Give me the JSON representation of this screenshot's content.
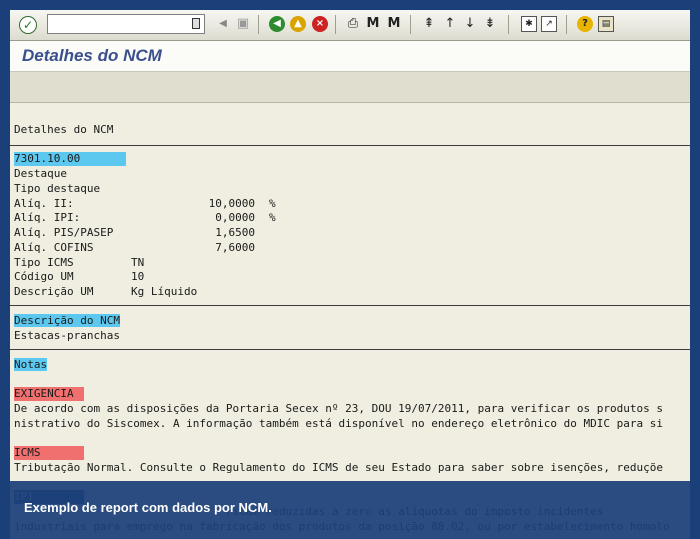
{
  "window": {
    "title": "Detalhes do NCM"
  },
  "toolbar": {
    "command_value": "",
    "icons": [
      "enter-icon",
      "back-icon",
      "save-icon",
      "back-nav-icon",
      "exit-icon",
      "cancel-icon",
      "print-icon",
      "find-icon",
      "find-next-icon",
      "first-page-icon",
      "prev-page-icon",
      "next-page-icon",
      "last-page-icon",
      "new-session-icon",
      "shortcut-icon",
      "help-icon",
      "layout-icon"
    ]
  },
  "report": {
    "heading": "Detalhes do NCM",
    "ncm_code": "7301.10.00",
    "fields": [
      {
        "label": "Destaque",
        "value": "",
        "unit": ""
      },
      {
        "label": "Tipo destaque",
        "value": "",
        "unit": ""
      },
      {
        "label": "Alíq. II:",
        "value": "10,0000",
        "unit": "%"
      },
      {
        "label": "Alíq. IPI:",
        "value": "0,0000",
        "unit": "%"
      },
      {
        "label": "Alíq. PIS/PASEP",
        "value": "1,6500",
        "unit": ""
      },
      {
        "label": "Alíq. COFINS",
        "value": "7,6000",
        "unit": ""
      },
      {
        "label": "Tipo ICMS",
        "value": "TN",
        "unit": ""
      },
      {
        "label": "Código UM",
        "value": "10",
        "unit": ""
      },
      {
        "label": "Descrição UM",
        "value": "Kg Líquido",
        "unit": ""
      }
    ],
    "descricao_header": "Descrição do NCM",
    "descricao_text": "Estacas-pranchas",
    "notas_header": "Notas",
    "sections": [
      {
        "header": "EXIGENCIA",
        "lines": [
          "De acordo com as disposições da Portaria Secex nº 23, DOU 19/07/2011, para verificar os produtos s",
          "nistrativo do Siscomex. A informação também está disponível no endereço eletrônico do MDIC para si"
        ]
      },
      {
        "header": "ICMS",
        "lines": [
          "Tributação Normal. Consulte o Regulamento do ICMS de seu Estado para saber sobre isenções, reduçõe"
        ]
      },
      {
        "header": "IPI",
        "lines": [
          "                                Ficam reduzidas a zero as alíquotas do imposto incidentes",
          "industriais para emprego na fabricação dos produtos da posição 88.02, ou por estabelecimento homolo"
        ]
      }
    ]
  },
  "caption": "Exemplo de report com dados por NCM.",
  "colors": {
    "frame": "#1b3f78",
    "highlight_blue": "#5cc8ef",
    "highlight_red": "#f07070",
    "title": "#3a4f8e"
  }
}
